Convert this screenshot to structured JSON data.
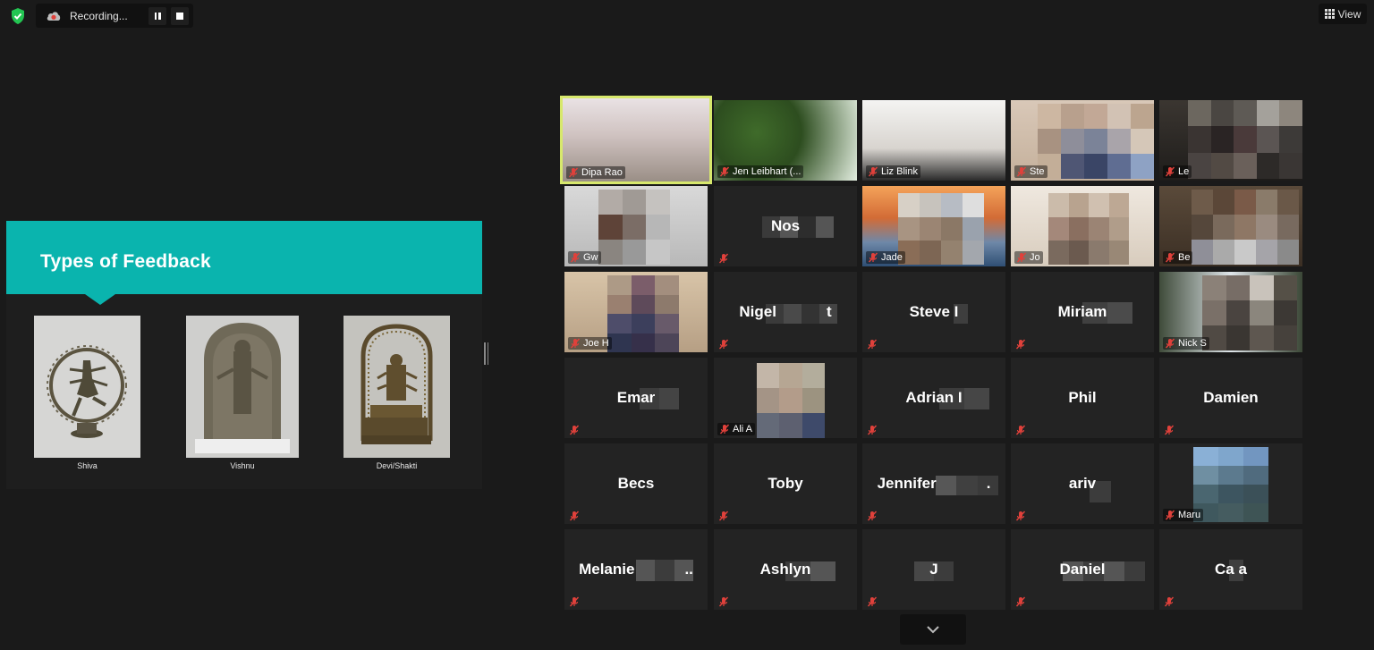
{
  "recording": {
    "status_text": "Recording...",
    "pause_icon": "pause-icon",
    "stop_icon": "stop-icon"
  },
  "view_button": {
    "label": "View"
  },
  "slide": {
    "title": "Types of Feedback",
    "accent_color": "#0ab4ae",
    "images": [
      {
        "caption": "Shiva"
      },
      {
        "caption": "Vishnu"
      },
      {
        "caption": "Devi/Shakti"
      }
    ]
  },
  "participants": [
    {
      "name": "Dipa Rao",
      "video": true,
      "speaking": true
    },
    {
      "name": "Jen Leibhart (...",
      "video": true
    },
    {
      "name": "Liz Blink",
      "video": true
    },
    {
      "name": "Ste",
      "video": true
    },
    {
      "name": "Le",
      "video": true
    },
    {
      "name": "Gw",
      "video": true
    },
    {
      "name": "Nos",
      "video": false
    },
    {
      "name": "Jade",
      "video": true
    },
    {
      "name": "Jo",
      "video": true
    },
    {
      "name": "Be",
      "video": true
    },
    {
      "name": "Joe H",
      "video": true
    },
    {
      "name": "Nigel",
      "suffix": "t",
      "video": false
    },
    {
      "name": "Steve I",
      "video": false
    },
    {
      "name": "Miriam",
      "video": false
    },
    {
      "name": "Nick S",
      "video": true
    },
    {
      "name": "Emar",
      "video": false
    },
    {
      "name": "Ali A",
      "video": true
    },
    {
      "name": "Adrian I",
      "video": false
    },
    {
      "name": "Phil",
      "video": false
    },
    {
      "name": "Damien",
      "video": false
    },
    {
      "name": "Becs",
      "video": false
    },
    {
      "name": "Toby",
      "video": false
    },
    {
      "name": "Jennifer",
      "suffix": ".",
      "video": false
    },
    {
      "name": "ariv",
      "video": false
    },
    {
      "name": "Maru",
      "video": true
    },
    {
      "name": "Melanie",
      "suffix": "..",
      "video": false
    },
    {
      "name": "Ashlyn",
      "video": false
    },
    {
      "name": "J",
      "video": false
    },
    {
      "name": "Daniel",
      "video": false
    },
    {
      "name": "Ca a",
      "video": false
    }
  ]
}
